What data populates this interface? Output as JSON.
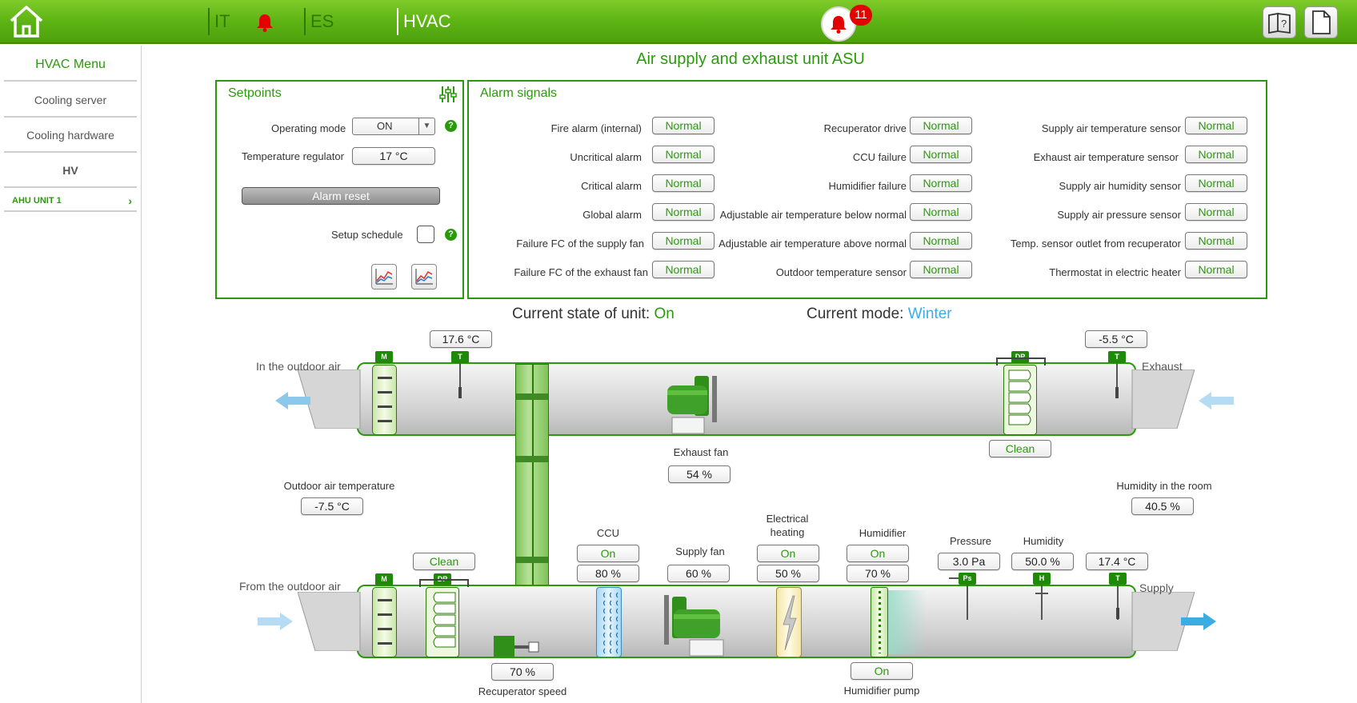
{
  "topbar": {
    "items": [
      "IT",
      "ES",
      "HVAC"
    ],
    "alarm_count": "11"
  },
  "sidebar": {
    "title": "HVAC Menu",
    "items": [
      "Cooling server",
      "Cooling hardware"
    ],
    "group": "HV",
    "active": "AHU UNIT 1"
  },
  "main": {
    "title": "Air supply and exhaust unit ASU"
  },
  "setpoints": {
    "title": "Setpoints",
    "operating_mode_label": "Operating mode",
    "operating_mode_value": "ON",
    "temp_regulator_label": "Temperature regulator",
    "temp_regulator_value": "17 °C",
    "alarm_reset_label": "Alarm reset",
    "setup_schedule_label": "Setup schedule"
  },
  "alarms": {
    "title": "Alarm signals",
    "col1": [
      {
        "label": "Fire alarm (internal)",
        "status": "Normal"
      },
      {
        "label": "Uncritical alarm",
        "status": "Normal"
      },
      {
        "label": "Critical alarm",
        "status": "Normal"
      },
      {
        "label": "Global alarm",
        "status": "Normal"
      },
      {
        "label": "Failure FC of the supply fan",
        "status": "Normal"
      },
      {
        "label": "Failure FC of the exhaust fan",
        "status": "Normal"
      }
    ],
    "col2": [
      {
        "label": "Recuperator drive",
        "status": "Normal"
      },
      {
        "label": "CCU failure",
        "status": "Normal"
      },
      {
        "label": "Humidifier failure",
        "status": "Normal"
      },
      {
        "label": "Adjustable air temperature below normal",
        "status": "Normal"
      },
      {
        "label": "Adjustable air temperature above normal",
        "status": "Normal"
      },
      {
        "label": "Outdoor temperature sensor",
        "status": "Normal"
      }
    ],
    "col3": [
      {
        "label": "Supply air temperature sensor",
        "status": "Normal"
      },
      {
        "label": "Exhaust air temperature sensor",
        "status": "Normal"
      },
      {
        "label": "Supply air humidity sensor",
        "status": "Normal"
      },
      {
        "label": "Supply air pressure sensor",
        "status": "Normal"
      },
      {
        "label": "Temp. sensor outlet from recuperator",
        "status": "Normal"
      },
      {
        "label": "Thermostat in electric heater",
        "status": "Normal"
      }
    ]
  },
  "state": {
    "unit_label": "Current state of unit:",
    "unit_value": "On",
    "mode_label": "Current mode:",
    "mode_value": "Winter"
  },
  "diagram": {
    "outdoor_in_label": "In the outdoor air",
    "exhaust_label": "Exhaust",
    "from_outdoor_label": "From the outdoor air",
    "supply_label": "Supply",
    "exhaust_intake_temp": "17.6 °C",
    "exhaust_out_temp": "-5.5 °C",
    "exhaust_filter_status": "Clean",
    "exhaust_fan_label": "Exhaust fan",
    "exhaust_fan_value": "54 %",
    "outdoor_temp_label": "Outdoor air temperature",
    "outdoor_temp_value": "-7.5 °C",
    "room_humidity_label": "Humidity in the room",
    "room_humidity_value": "40.5 %",
    "supply_filter_status": "Clean",
    "recuperator_value": "70 %",
    "recuperator_label": "Recuperator speed",
    "ccu_label": "CCU",
    "ccu_state": "On",
    "ccu_value": "80 %",
    "supply_fan_label": "Supply fan",
    "supply_fan_value": "60 %",
    "heating_label_1": "Electrical",
    "heating_label_2": "heating",
    "heating_state": "On",
    "heating_value": "50 %",
    "humidifier_label": "Humidifier",
    "humidifier_state": "On",
    "humidifier_value": "70 %",
    "pressure_label": "Pressure",
    "pressure_value": "3.0 Pa",
    "humidity_label": "Humidity",
    "humidity_value": "50.0 %",
    "supply_temp_value": "17.4 °C",
    "humidifier_pump_state": "On",
    "humidifier_pump_label": "Humidifier pump",
    "tags": {
      "m": "M",
      "t": "T",
      "dp": "DP",
      "ps": "Ps",
      "h": "H"
    }
  },
  "colors": {
    "accent": "#2a9a0c",
    "mode_value": "#3aaee0",
    "topbar": "#5db414",
    "alarm_badge": "#e20000"
  }
}
